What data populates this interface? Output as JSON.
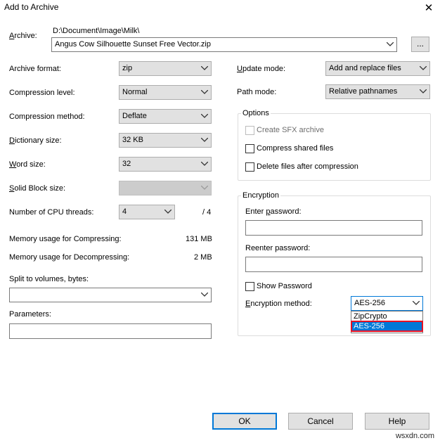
{
  "window": {
    "title": "Add to Archive",
    "close_label": "✕"
  },
  "archive": {
    "label": "Archive:",
    "path": "D:\\Document\\Image\\Milk\\",
    "value": "Angus Cow Silhouette Sunset Free Vector.zip",
    "browse_label": "..."
  },
  "left": {
    "archive_format": {
      "label": "Archive format:",
      "value": "zip"
    },
    "compression_level": {
      "label": "Compression level:",
      "value": "Normal"
    },
    "compression_method": {
      "label": "Compression method:",
      "value": "Deflate"
    },
    "dictionary_size": {
      "label": "Dictionary size:",
      "value": "32 KB"
    },
    "word_size": {
      "label": "Word size:",
      "value": "32"
    },
    "solid_block_size": {
      "label": "Solid Block size:",
      "value": ""
    },
    "cpu_threads": {
      "label": "Number of CPU threads:",
      "value": "4",
      "total": "/ 4"
    },
    "memory_compress": {
      "label": "Memory usage for Compressing:",
      "value": "131 MB"
    },
    "memory_decompress": {
      "label": "Memory usage for Decompressing:",
      "value": "2 MB"
    },
    "split_volumes": {
      "label": "Split to volumes, bytes:",
      "value": ""
    },
    "parameters": {
      "label": "Parameters:",
      "value": ""
    }
  },
  "right": {
    "update_mode": {
      "label": "Update mode:",
      "value": "Add and replace files"
    },
    "path_mode": {
      "label": "Path mode:",
      "value": "Relative pathnames"
    },
    "options": {
      "title": "Options",
      "create_sfx": "Create SFX archive",
      "compress_shared": "Compress shared files",
      "delete_after": "Delete files after compression"
    },
    "encryption": {
      "title": "Encryption",
      "enter_password_label": "Enter password:",
      "reenter_password_label": "Reenter password:",
      "show_password": "Show Password",
      "method_label": "Encryption method:",
      "method_value": "AES-256",
      "method_options": [
        "ZipCrypto",
        "AES-256"
      ]
    }
  },
  "buttons": {
    "ok": "OK",
    "cancel": "Cancel",
    "help": "Help"
  },
  "watermark": "wsxdn.com"
}
